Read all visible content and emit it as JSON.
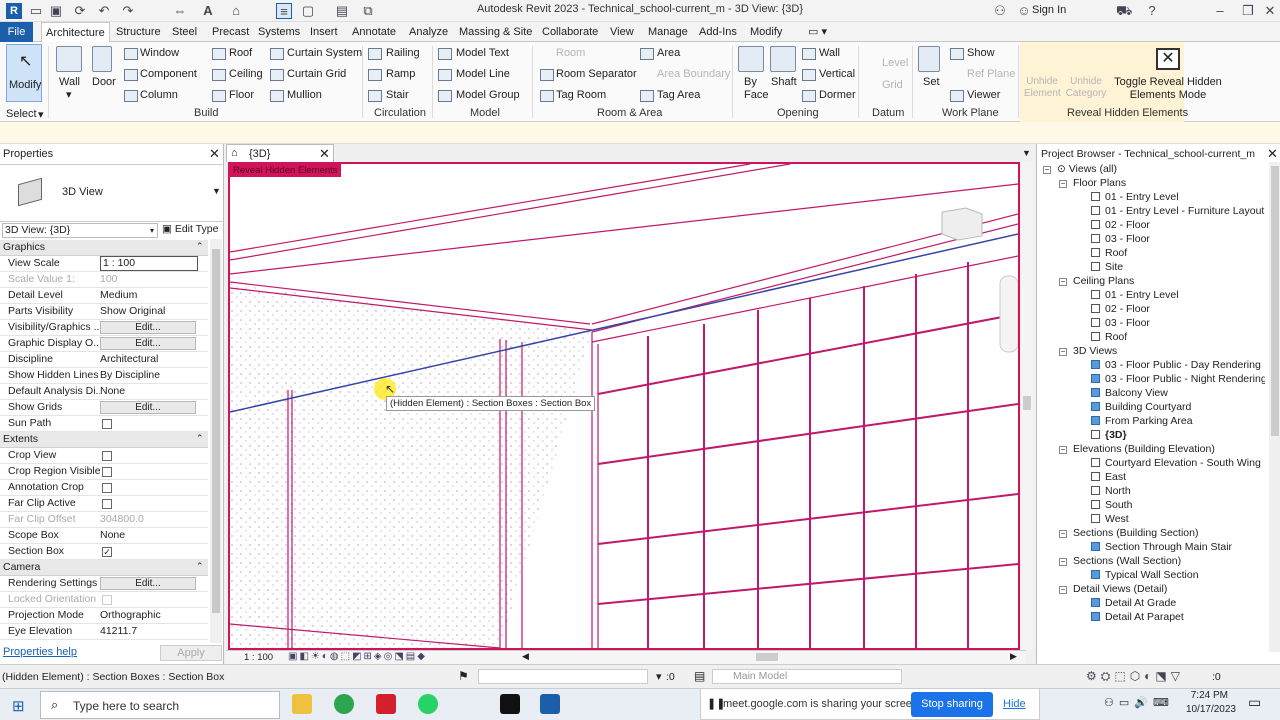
{
  "window": {
    "title": "Autodesk Revit 2023 - Technical_school-current_m - 3D View: {3D}",
    "sign_in": "Sign In"
  },
  "tabs": [
    "File",
    "Architecture",
    "Structure",
    "Steel",
    "Precast",
    "Systems",
    "Insert",
    "Annotate",
    "Analyze",
    "Massing & Site",
    "Collaborate",
    "View",
    "Manage",
    "Add-Ins",
    "Modify"
  ],
  "ribbon": {
    "modify": "Modify",
    "select": "Select",
    "wall": "Wall",
    "door": "Door",
    "window": "Window",
    "component": "Component",
    "column": "Column",
    "roof": "Roof",
    "ceiling": "Ceiling",
    "floor": "Floor",
    "curtain_system": "Curtain System",
    "curtain_grid": "Curtain Grid",
    "mullion": "Mullion",
    "railing": "Railing",
    "ramp": "Ramp",
    "stair": "Stair",
    "model_text": "Model Text",
    "model_line": "Model Line",
    "model_group": "Model Group",
    "room": "Room",
    "room_separator": "Room Separator",
    "tag_room": "Tag Room",
    "area": "Area",
    "area_boundary": "Area Boundary",
    "tag_area": "Tag Area",
    "by_face": "By Face",
    "shaft": "Shaft",
    "wall_opening": "Wall",
    "vertical": "Vertical",
    "dormer": "Dormer",
    "level": "Level",
    "grid": "Grid",
    "set": "Set",
    "show": "Show",
    "ref_plane": "Ref Plane",
    "viewer": "Viewer",
    "unhide_element": "Unhide Element",
    "unhide_category": "Unhide Category",
    "toggle_reveal": "Toggle Reveal Hidden Elements Mode",
    "panels": {
      "build": "Build",
      "circulation": "Circulation",
      "model": "Model",
      "room_area": "Room & Area",
      "opening": "Opening",
      "datum": "Datum",
      "work_plane": "Work Plane",
      "reveal_hidden": "Reveal Hidden Elements"
    }
  },
  "properties": {
    "header": "Properties",
    "type_name": "3D View",
    "selector": "3D View: {3D}",
    "edit_type": "Edit Type",
    "help": "Properties help",
    "apply": "Apply",
    "groups": {
      "graphics": "Graphics",
      "extents": "Extents",
      "camera": "Camera"
    },
    "rows": [
      {
        "name": "View Scale",
        "value": "1 : 100"
      },
      {
        "name": "Scale Value    1:",
        "value": "100"
      },
      {
        "name": "Detail Level",
        "value": "Medium"
      },
      {
        "name": "Parts Visibility",
        "value": "Show Original"
      },
      {
        "name": "Visibility/Graphics ...",
        "value": "Edit..."
      },
      {
        "name": "Graphic Display O...",
        "value": "Edit..."
      },
      {
        "name": "Discipline",
        "value": "Architectural"
      },
      {
        "name": "Show Hidden Lines",
        "value": "By Discipline"
      },
      {
        "name": "Default Analysis Di...",
        "value": "None"
      },
      {
        "name": "Show Grids",
        "value": "Edit..."
      },
      {
        "name": "Sun Path",
        "value": ""
      },
      {
        "name": "Crop View",
        "value": ""
      },
      {
        "name": "Crop Region Visible",
        "value": ""
      },
      {
        "name": "Annotation Crop",
        "value": ""
      },
      {
        "name": "Far Clip Active",
        "value": ""
      },
      {
        "name": "Far Clip Offset",
        "value": "304800.0"
      },
      {
        "name": "Scope Box",
        "value": "None"
      },
      {
        "name": "Section Box",
        "value": ""
      },
      {
        "name": "Rendering Settings",
        "value": "Edit..."
      },
      {
        "name": "Locked Orientation",
        "value": ""
      },
      {
        "name": "Projection Mode",
        "value": "Orthographic"
      },
      {
        "name": "Eye Elevation",
        "value": "41211.7"
      }
    ]
  },
  "view": {
    "tab_label": "{3D}",
    "reveal_banner": "Reveal Hidden Elements",
    "tooltip": "(Hidden Element) : Section Boxes : Section Box",
    "scale": "1 : 100"
  },
  "browser": {
    "header": "Project Browser - Technical_school-current_m",
    "root": "Views (all)",
    "groups": [
      {
        "label": "Floor Plans",
        "items": [
          "01 - Entry Level",
          "01 - Entry Level - Furniture Layout",
          "02 - Floor",
          "03 - Floor",
          "Roof",
          "Site"
        ]
      },
      {
        "label": "Ceiling Plans",
        "items": [
          "01 - Entry Level",
          "02 - Floor",
          "03 - Floor",
          "Roof"
        ]
      },
      {
        "label": "3D Views",
        "items": [
          "03 - Floor Public - Day Rendering",
          "03 - Floor Public - Night Rendering",
          "Balcony View",
          "Building Courtyard",
          "From Parking Area",
          "{3D}"
        ]
      },
      {
        "label": "Elevations (Building Elevation)",
        "items": [
          "Courtyard Elevation - South Wing",
          "East",
          "North",
          "South",
          "West"
        ]
      },
      {
        "label": "Sections (Building Section)",
        "items": [
          "Section Through Main Stair"
        ]
      },
      {
        "label": "Sections (Wall Section)",
        "items": [
          "Typical Wall Section"
        ]
      },
      {
        "label": "Detail Views (Detail)",
        "items": [
          "Detail At Grade",
          "Detail At Parapet"
        ]
      }
    ]
  },
  "status": {
    "text": "(Hidden Element) : Section Boxes : Section Box",
    "zero": ":0",
    "model": "Main Model"
  },
  "taskbar": {
    "search_placeholder": "Type here to search",
    "share_text": "meet.google.com is sharing your screen.",
    "stop_sharing": "Stop sharing",
    "hide": "Hide",
    "time": "7:24 PM",
    "date": "10/17/2023"
  }
}
